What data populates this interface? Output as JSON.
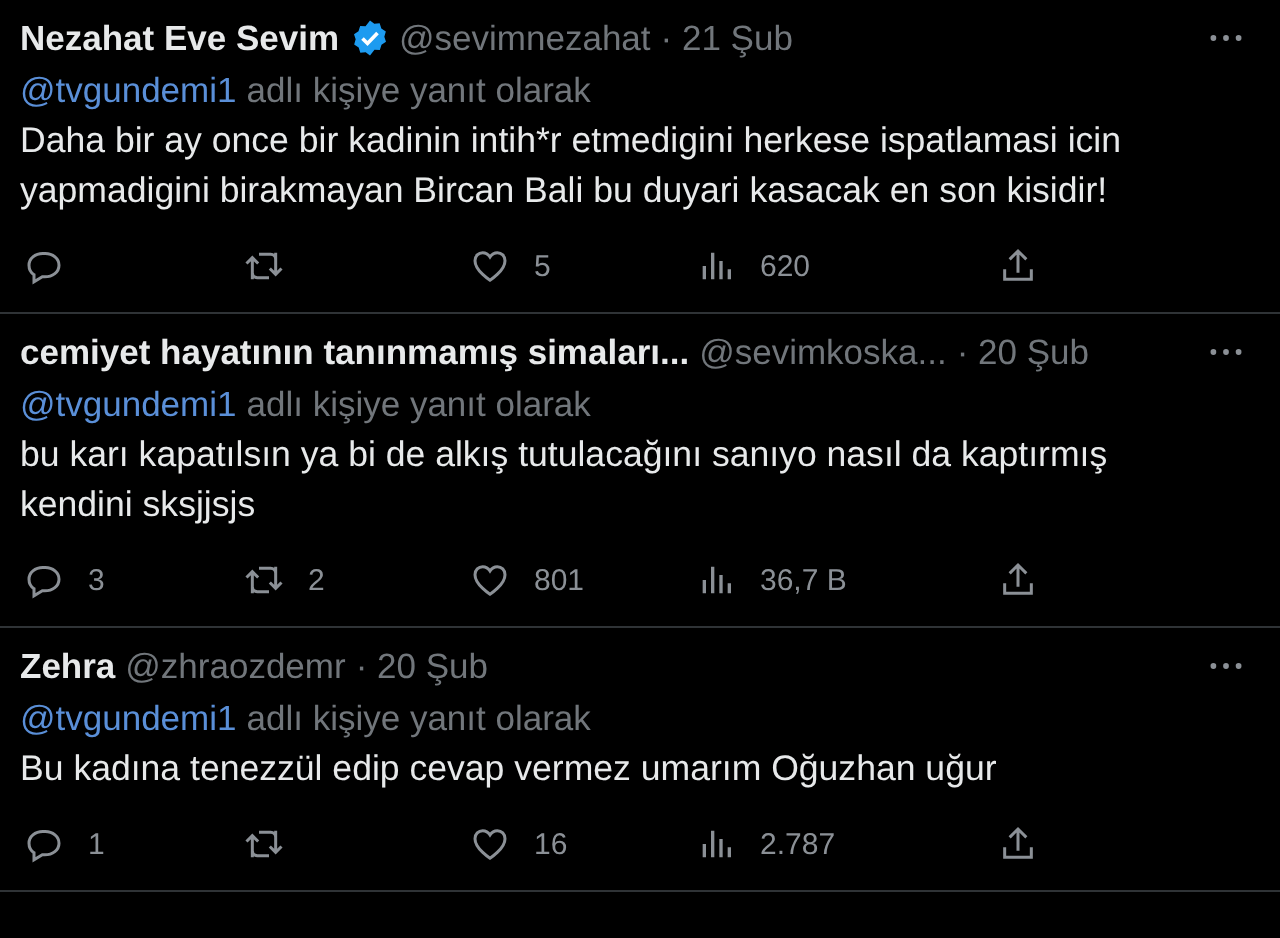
{
  "tweets": [
    {
      "name": "Nezahat Eve Sevim",
      "verified": true,
      "handle": "@sevimnezahat",
      "date": "· 21 Şub",
      "reply_to": "@tvgundemi1",
      "reply_suffix": "adlı kişiye yanıt olarak",
      "text": "Daha bir ay once bir kadinin intih*r etmedigini herkese ispatlamasi icin yapmadigini birakmayan Bircan Bali bu duyari kasacak en son kisidir!",
      "actions": [
        {
          "kind": "reply"
        },
        {
          "kind": "retweet"
        },
        {
          "kind": "like",
          "count": "5"
        },
        {
          "kind": "views",
          "count": "620"
        },
        {
          "kind": "share"
        }
      ]
    },
    {
      "name": "cemiyet hayatının tanınmamış simaları...",
      "verified": false,
      "handle": "@sevimkoska...",
      "date": "· 20 Şub",
      "reply_to": "@tvgundemi1",
      "reply_suffix": "adlı kişiye yanıt olarak",
      "text": "bu karı kapatılsın ya bi de alkış tutulacağını sanıyo nasıl da kaptırmış kendini sksjjsjs",
      "actions": [
        {
          "kind": "reply",
          "count": "3"
        },
        {
          "kind": "retweet",
          "count": "2"
        },
        {
          "kind": "like",
          "count": "801"
        },
        {
          "kind": "views",
          "count": "36,7 B"
        },
        {
          "kind": "share"
        }
      ]
    },
    {
      "name": "Zehra",
      "verified": false,
      "handle": "@zhraozdemr",
      "date": "· 20 Şub",
      "reply_to": "@tvgundemi1",
      "reply_suffix": "adlı kişiye yanıt olarak",
      "text": "Bu kadına tenezzül edip cevap vermez umarım Oğuzhan uğur",
      "actions": [
        {
          "kind": "reply",
          "count": "1"
        },
        {
          "kind": "retweet"
        },
        {
          "kind": "like",
          "count": "16"
        },
        {
          "kind": "views",
          "count": "2.787"
        },
        {
          "kind": "share"
        }
      ]
    }
  ]
}
